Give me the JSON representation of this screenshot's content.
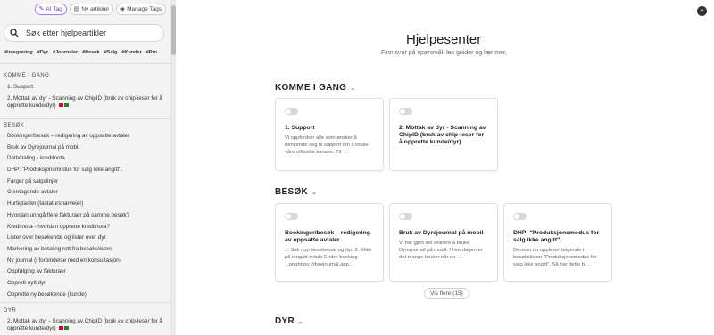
{
  "toolbar": {
    "ai_tag": "AI Tag",
    "new_article": "Ny artikkel",
    "manage_tags": "Manage Tags"
  },
  "search": {
    "placeholder": "Søk etter hjelpeartikler"
  },
  "tags": [
    "#integrering",
    "#Dyr",
    "#Journaler",
    "#Besøk",
    "#Salg",
    "#Kunder",
    "#Pro"
  ],
  "sidebar": {
    "sections": [
      {
        "title": "KOMME I GANG",
        "items": [
          "1. Support",
          "2. Mottak av dyr - Scanning av ChipID (bruk av chip-leser for å opprette kunde/dyr)"
        ]
      },
      {
        "title": "BESØK",
        "items": [
          "Bookinger/besøk – redigering av oppsatte avtaler",
          "Bruk av Dyrejournal på mobil",
          "Delbetaling - kreditnota",
          "DHP: \"Produksjonsmodus for salg ikke angitt\".",
          "Farger på salgslinjer",
          "Gjentagende avtaler",
          "Hurtigtaster (tastatursnarveier)",
          "Hvordan unngå flere fakturaer på samme besøk?",
          "Kreditnota - hvordan opprette kreditnota?",
          "Lister over besøkende og lister over dyr",
          "Markering av betaling rett fra besøkslisten",
          "Ny journal (i forbindelse med en konsultasjon)",
          "Oppfølging av fakturaer",
          "Opprett nytt dyr",
          "Opprette ny besøkende (kunde)"
        ]
      },
      {
        "title": "DYR",
        "items": [
          "2. Mottak av dyr - Scanning av ChipID (bruk av chip-leser for å opprette kunde/dyr)"
        ]
      }
    ]
  },
  "main": {
    "title": "Hjelpesenter",
    "subtitle": "Finn svar på spørsmål, les guider og lær mer.",
    "close_icon": "×",
    "categories": [
      {
        "title": "KOMME I GANG",
        "cards": [
          {
            "title": "1. Support",
            "desc": "Vi oppfordrer alle som ønsker å henvende seg til support om å bruke våre offisielle kanaler. Til: …"
          },
          {
            "title": "2. Mottak av dyr - Scanning av ChipID (bruk av chip-leser for å opprette kunde/dyr)",
            "desc": ""
          }
        ]
      },
      {
        "title": "BESØK",
        "cards": [
          {
            "title": "Bookinger/besøk – redigering av oppsatte avtaler",
            "desc": "1. Sok opp besøkende og dyr. 2. Klikk på inngått avtale Endre booking 1.pnghttps://dyrejournal.app…"
          },
          {
            "title": "Bruk av Dyrejournal på mobil",
            "desc": "Vi har gjort det enklere å bruke Dyrejournal på mobil. I hverdagen er det mange bruker når de …"
          },
          {
            "title": "DHP: \"Produksjonsmodus for salg ikke angitt\".",
            "desc": "Dersom du opplever følgende i besøkslisten \"Produksjonsmodus for salg ikke angitt\". Så har dette bl…"
          }
        ],
        "more_label": "Vis flere (15)"
      },
      {
        "title": "DYR"
      }
    ]
  },
  "colors": {
    "accent": "#6b3fc7",
    "sidebar_bg": "#f3f3f4"
  }
}
